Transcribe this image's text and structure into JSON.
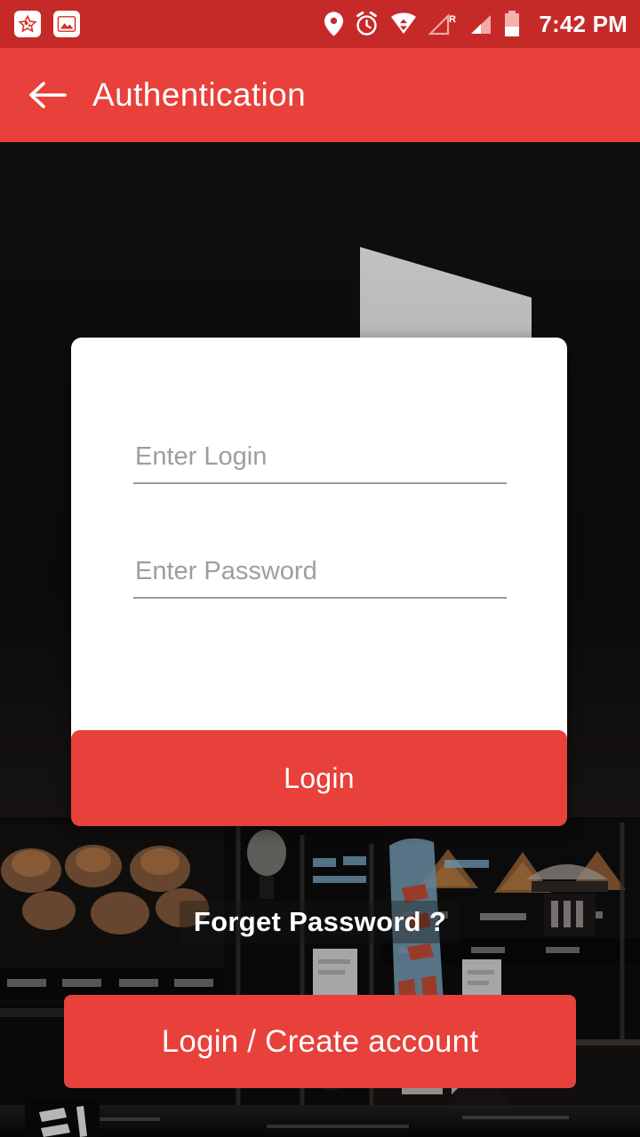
{
  "status_bar": {
    "time": "7:42 PM",
    "background_color": "#c62a28",
    "left_icons": [
      {
        "name": "star-notification-icon",
        "glyph": "★"
      },
      {
        "name": "photo-notification-icon",
        "glyph": "▲"
      }
    ],
    "right_icons": [
      {
        "name": "location-pin-icon"
      },
      {
        "name": "alarm-clock-icon"
      },
      {
        "name": "wifi-icon"
      },
      {
        "name": "signal-roaming-icon",
        "label": "R"
      },
      {
        "name": "signal-bars-icon"
      },
      {
        "name": "battery-icon"
      }
    ]
  },
  "app_bar": {
    "title": "Authentication",
    "back_label": "Back",
    "background_color": "#e8403a"
  },
  "form": {
    "login_placeholder": "Enter Login",
    "login_value": "",
    "password_placeholder": "Enter Password",
    "password_value": "",
    "login_button_label": "Login"
  },
  "links": {
    "forget_password_label": "Forget Password ?"
  },
  "footer": {
    "create_account_label": "Login / Create account"
  },
  "theme": {
    "accent": "#e8403a",
    "status_bar": "#c62a28",
    "card_background": "#ffffff",
    "placeholder_color": "#9e9e9e"
  },
  "background": {
    "description": "Night street food market photo, dark tone"
  }
}
